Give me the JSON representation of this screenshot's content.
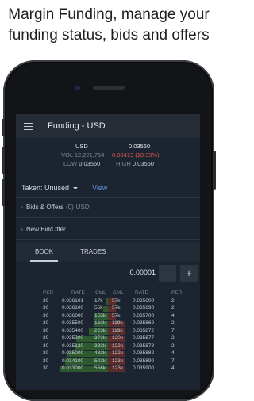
{
  "headline": {
    "line1": "Margin Funding,  manage your",
    "line2": "funding status, bids and offers"
  },
  "appbar": {
    "title": "Funding - USD"
  },
  "ticker": {
    "currency": "USD",
    "price": "0.03560",
    "vol_label": "VOL",
    "vol": "12,221,764",
    "change": "0.00413 (10.39%)",
    "low_label": "LOW",
    "low": "0.03560",
    "high_label": "HIGH",
    "high": "0.03560"
  },
  "taken": {
    "label": "Taken: Unused",
    "view": "View"
  },
  "bids_offers": {
    "label": "Bids & Offers",
    "count": "(0)",
    "currency": "USD"
  },
  "new_bid": {
    "label": "New Bid/Offer"
  },
  "tabs": {
    "book": "BOOK",
    "trades": "TRADES"
  },
  "precision": {
    "value": "0.00001",
    "minus": "−",
    "plus": "+"
  },
  "book": {
    "headers": [
      "PER",
      "RATE",
      "CML",
      "CML",
      "RATE",
      "PER"
    ],
    "rows": [
      [
        "30",
        "0.036101",
        "17k",
        "57k",
        "0.035600",
        "2"
      ],
      [
        "30",
        "0.036100",
        "55k",
        "57k",
        "0.035690",
        "2"
      ],
      [
        "30",
        "0.036000",
        "155k",
        "57k",
        "0.035700",
        "4"
      ],
      [
        "30",
        "0.035500",
        "163k",
        "119k",
        "0.035869",
        "2"
      ],
      [
        "30",
        "0.035400",
        "223k",
        "119k",
        "0.035872",
        "7"
      ],
      [
        "30",
        "0.035200",
        "373k",
        "120k",
        "0.035877",
        "2"
      ],
      [
        "30",
        "0.035120",
        "383k",
        "122k",
        "0.035878",
        "2"
      ],
      [
        "30",
        "0.035000",
        "483k",
        "122k",
        "0.035882",
        "4"
      ],
      [
        "30",
        "0.034100",
        "503k",
        "123k",
        "0.035890",
        "7"
      ],
      [
        "30",
        "0.033000",
        "556k",
        "123k",
        "0.035900",
        "4"
      ]
    ]
  },
  "colors": {
    "screen_bg": "#1b2430",
    "bid": "#2c5a2e",
    "ask": "#5a2c2c",
    "accent": "#5b8ed6",
    "negative": "#e0574f"
  }
}
